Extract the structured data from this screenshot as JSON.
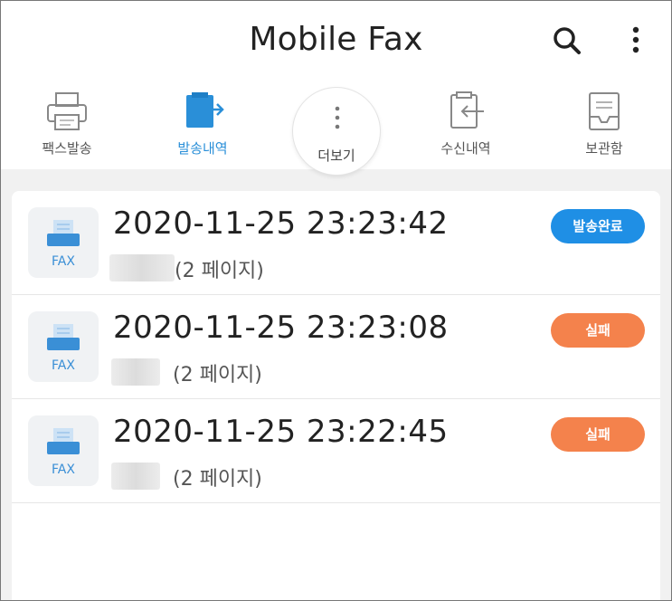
{
  "app": {
    "title": "Mobile Fax"
  },
  "appbar": {
    "search_icon": "search-icon",
    "more_icon": "more-vertical-icon"
  },
  "tabs": [
    {
      "label": "팩스발송",
      "icon": "printer-icon",
      "active": false
    },
    {
      "label": "발송내역",
      "icon": "sent-fax-icon",
      "active": true
    },
    {
      "label": "더보기",
      "icon": "more-dots-icon",
      "active": false
    },
    {
      "label": "수신내역",
      "icon": "received-fax-icon",
      "active": false
    },
    {
      "label": "보관함",
      "icon": "archive-icon",
      "active": false
    }
  ],
  "colors": {
    "accent": "#2a8fd8",
    "success": "#1f8fe5",
    "fail": "#f4824c",
    "background": "#f1f1f1"
  },
  "history": [
    {
      "thumb_label": "FAX",
      "datetime": "2020-11-25 23:23:42",
      "pages": "(2 페이지)",
      "status": "발송완료",
      "status_type": "success"
    },
    {
      "thumb_label": "FAX",
      "datetime": "2020-11-25 23:23:08",
      "pages": "(2 페이지)",
      "status": "실패",
      "status_type": "fail"
    },
    {
      "thumb_label": "FAX",
      "datetime": "2020-11-25 23:22:45",
      "pages": "(2 페이지)",
      "status": "실패",
      "status_type": "fail"
    }
  ]
}
